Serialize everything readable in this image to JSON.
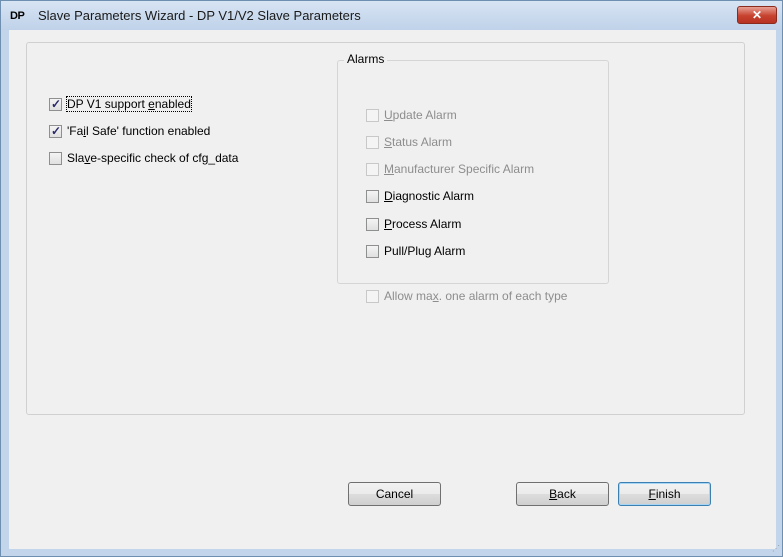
{
  "window": {
    "icon_text": "DP",
    "title": "Slave Parameters Wizard - DP V1/V2 Slave Parameters",
    "close_glyph": "✕"
  },
  "left_options": [
    {
      "pre": "DP V1 support ",
      "u": "e",
      "post": "nabled",
      "checked": true,
      "enabled": true,
      "focused": true
    },
    {
      "pre": "'Fa",
      "u": "i",
      "post": "l Safe' function enabled",
      "checked": true,
      "enabled": true,
      "focused": false
    },
    {
      "pre": "Sla",
      "u": "v",
      "post": "e-specific check of cfg_data",
      "checked": false,
      "enabled": true,
      "focused": false
    }
  ],
  "alarms": {
    "title": "Alarms",
    "items": [
      {
        "pre": "",
        "u": "U",
        "post": "pdate Alarm",
        "checked": false,
        "enabled": false
      },
      {
        "pre": "",
        "u": "S",
        "post": "tatus Alarm",
        "checked": false,
        "enabled": false
      },
      {
        "pre": "",
        "u": "M",
        "post": "anufacturer Specific Alarm",
        "checked": false,
        "enabled": false
      },
      {
        "pre": "",
        "u": "D",
        "post": "iagnostic Alarm",
        "checked": false,
        "enabled": true
      },
      {
        "pre": "",
        "u": "P",
        "post": "rocess Alarm",
        "checked": false,
        "enabled": true
      },
      {
        "pre": "Pull/Plu",
        "u": "g",
        "post": " Alarm",
        "checked": false,
        "enabled": true
      }
    ],
    "max_one": {
      "pre": "Allow ma",
      "u": "x",
      "post": ". one alarm of each type",
      "checked": false,
      "enabled": false
    }
  },
  "buttons": {
    "cancel": "Cancel",
    "back": {
      "pre": "",
      "u": "B",
      "post": "ack"
    },
    "finish": {
      "pre": "",
      "u": "F",
      "post": "inish"
    }
  },
  "icons": {
    "close": "close-icon",
    "checkbox_checked": "checkmark-icon",
    "resize": "resize-grip-icon"
  },
  "colors": {
    "title_bar": "#c3d5ea",
    "close_button": "#c7422f",
    "disabled_text": "#8d8d8d",
    "dialog_face": "#f0f0f0"
  }
}
